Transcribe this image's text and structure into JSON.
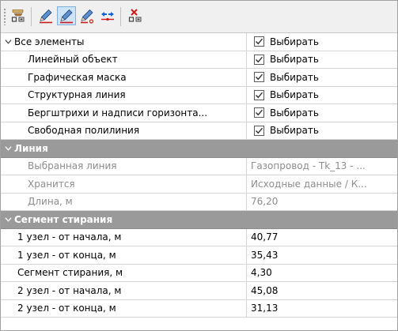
{
  "toolbar": {
    "buttons": [
      {
        "icon": "select-layer-icon"
      },
      {
        "icon": "pencil-icon"
      },
      {
        "icon": "pencil-active-icon",
        "active": true
      },
      {
        "icon": "pencil-line-icon"
      },
      {
        "icon": "move-arrows-icon"
      },
      {
        "icon": "delete-node-icon"
      }
    ]
  },
  "filter": {
    "all_label": "Все элементы",
    "all_value": "Выбирать",
    "items": [
      {
        "label": "Линейный объект",
        "value": "Выбирать",
        "checked": true
      },
      {
        "label": "Графическая маска",
        "value": "Выбирать",
        "checked": true
      },
      {
        "label": "Структурная линия",
        "value": "Выбирать",
        "checked": true
      },
      {
        "label": "Бергштрихи и надписи горизонта...",
        "value": "Выбирать",
        "checked": true
      },
      {
        "label": "Свободная полилиния",
        "value": "Выбирать",
        "checked": true
      }
    ]
  },
  "line_section": {
    "title": "Линия",
    "rows": [
      {
        "label": "Выбранная линия",
        "value": "Газопровод - Tk_13 - ..."
      },
      {
        "label": "Хранится",
        "value": "Исходные данные / К..."
      },
      {
        "label": "Длина, м",
        "value": "76,20"
      }
    ]
  },
  "segment_section": {
    "title": "Сегмент стирания",
    "rows": [
      {
        "label": "1 узел - от начала, м",
        "value": "40,77"
      },
      {
        "label": "1 узел - от конца, м",
        "value": "35,43"
      },
      {
        "label": "Сегмент стирания, м",
        "value": "4,30"
      },
      {
        "label": "2 узел - от начала, м",
        "value": "45,08"
      },
      {
        "label": "2 узел - от конца, м",
        "value": "31,13"
      }
    ]
  },
  "colors": {
    "category_header": "#9a9a9a",
    "active_button": "#cde3f7",
    "red_accent": "#d01818",
    "blue_accent": "#1060d0"
  }
}
